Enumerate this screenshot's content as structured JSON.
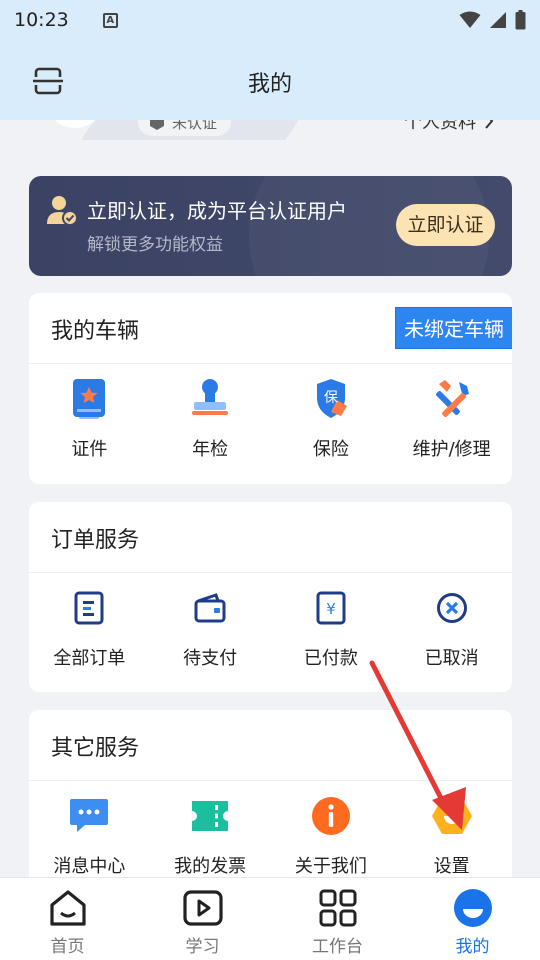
{
  "status_bar": {
    "time": "10:23"
  },
  "header": {
    "title": "我的"
  },
  "profile": {
    "verify_status": "未认证",
    "profile_link": "个人资料"
  },
  "banner": {
    "title": "立即认证，成为平台认证用户",
    "subtitle": "解锁更多功能权益",
    "button": "立即认证"
  },
  "vehicles": {
    "title": "我的车辆",
    "bind_tag": "未绑定车辆",
    "items": [
      {
        "label": "证件",
        "icon": "certificate-icon"
      },
      {
        "label": "年检",
        "icon": "stamp-icon"
      },
      {
        "label": "保险",
        "icon": "insurance-shield-icon"
      },
      {
        "label": "维护/修理",
        "icon": "repair-tools-icon"
      }
    ]
  },
  "orders": {
    "title": "订单服务",
    "items": [
      {
        "label": "全部订单",
        "icon": "order-list-icon"
      },
      {
        "label": "待支付",
        "icon": "wallet-icon"
      },
      {
        "label": "已付款",
        "icon": "paid-receipt-icon"
      },
      {
        "label": "已取消",
        "icon": "cancel-circle-icon"
      }
    ]
  },
  "others": {
    "title": "其它服务",
    "items": [
      {
        "label": "消息中心",
        "icon": "message-icon"
      },
      {
        "label": "我的发票",
        "icon": "ticket-icon"
      },
      {
        "label": "关于我们",
        "icon": "info-icon"
      },
      {
        "label": "设置",
        "icon": "settings-hexagon-icon"
      }
    ]
  },
  "tabbar": {
    "items": [
      {
        "label": "首页",
        "icon": "home-icon",
        "active": false
      },
      {
        "label": "学习",
        "icon": "play-video-icon",
        "active": false
      },
      {
        "label": "工作台",
        "icon": "grid-icon",
        "active": false
      },
      {
        "label": "我的",
        "icon": "profile-icon",
        "active": true
      }
    ]
  },
  "colors": {
    "header_bg": "#d8ecfb",
    "primary_blue": "#1a73e8",
    "banner_bg": "#3f4668",
    "banner_button": "#fbe3b3",
    "annotation_arrow": "#e53935"
  }
}
